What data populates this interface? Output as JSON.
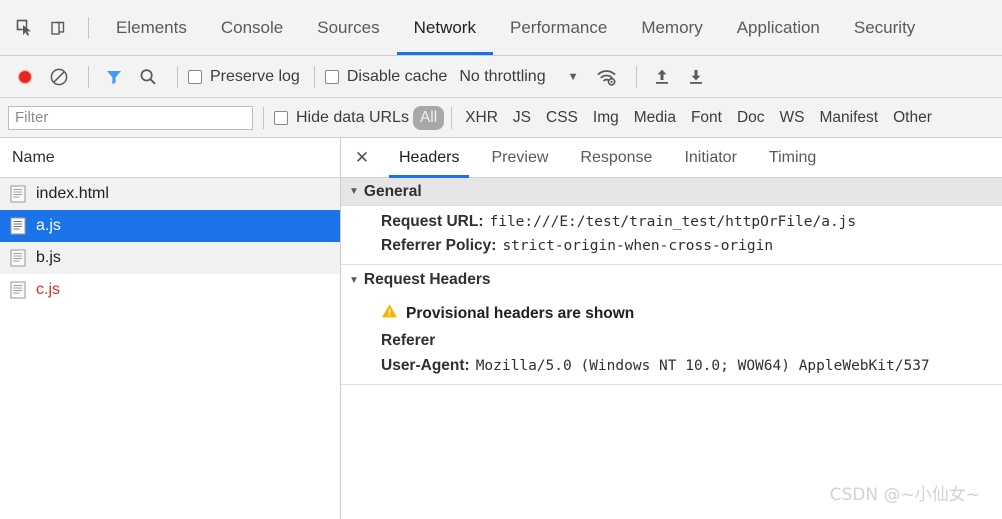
{
  "panel_tabs": [
    {
      "label": "Elements",
      "active": false
    },
    {
      "label": "Console",
      "active": false
    },
    {
      "label": "Sources",
      "active": false
    },
    {
      "label": "Network",
      "active": true
    },
    {
      "label": "Performance",
      "active": false
    },
    {
      "label": "Memory",
      "active": false
    },
    {
      "label": "Application",
      "active": false
    },
    {
      "label": "Security",
      "active": false
    }
  ],
  "top_icons": {
    "inspect": "inspect-element-icon",
    "device": "device-toolbar-icon"
  },
  "toolbar": {
    "record_icon": "record-button-icon",
    "clear_icon": "clear-icon",
    "filter_icon": "filter-icon",
    "search_icon": "search-icon",
    "preserve_log_label": "Preserve log",
    "preserve_log_checked": false,
    "disable_cache_label": "Disable cache",
    "disable_cache_checked": false,
    "throttling_value": "No throttling",
    "throttling_caret": "▼",
    "wifi_icon": "network-conditions-icon",
    "import_icon": "import-har-icon",
    "export_icon": "export-har-icon"
  },
  "filterbar": {
    "filter_placeholder": "Filter",
    "filter_value": "",
    "hide_data_urls_label": "Hide data URLs",
    "hide_data_urls_checked": false,
    "types": [
      {
        "label": "All",
        "active": true
      },
      {
        "label": "XHR",
        "active": false
      },
      {
        "label": "JS",
        "active": false
      },
      {
        "label": "CSS",
        "active": false
      },
      {
        "label": "Img",
        "active": false
      },
      {
        "label": "Media",
        "active": false
      },
      {
        "label": "Font",
        "active": false
      },
      {
        "label": "Doc",
        "active": false
      },
      {
        "label": "WS",
        "active": false
      },
      {
        "label": "Manifest",
        "active": false
      },
      {
        "label": "Other",
        "active": false
      }
    ]
  },
  "request_list": {
    "column_header": "Name",
    "rows": [
      {
        "name": "index.html",
        "selected": false,
        "error": false,
        "stripe": true
      },
      {
        "name": "a.js",
        "selected": true,
        "error": false,
        "stripe": false
      },
      {
        "name": "b.js",
        "selected": false,
        "error": false,
        "stripe": true
      },
      {
        "name": "c.js",
        "selected": false,
        "error": true,
        "stripe": false
      }
    ]
  },
  "detail": {
    "close_label": "✕",
    "tabs": [
      {
        "label": "Headers",
        "active": true
      },
      {
        "label": "Preview",
        "active": false
      },
      {
        "label": "Response",
        "active": false
      },
      {
        "label": "Initiator",
        "active": false
      },
      {
        "label": "Timing",
        "active": false
      }
    ],
    "sections": [
      {
        "title": "General",
        "expanded": true,
        "rows": [
          {
            "key": "Request URL:",
            "value": "file:///E:/test/train_test/httpOrFile/a.js"
          },
          {
            "key": "Referrer Policy:",
            "value": "strict-origin-when-cross-origin"
          }
        ]
      },
      {
        "title": "Request Headers",
        "expanded": true,
        "warning": {
          "icon": "warning-triangle-icon",
          "text": "Provisional headers are shown"
        },
        "solo_rows": [
          "Referer"
        ],
        "rows": [
          {
            "key": "User-Agent:",
            "value": "Mozilla/5.0 (Windows NT 10.0; WOW64) AppleWebKit/537"
          }
        ]
      }
    ]
  },
  "watermark": "CSDN @~小仙女~",
  "colors": {
    "accent": "#1a73e8",
    "error": "#d93025",
    "record": "#e8261f",
    "warning": "#f5b400",
    "toolbar_bg": "#f3f3f3",
    "section_bg": "#e6e6e6"
  }
}
